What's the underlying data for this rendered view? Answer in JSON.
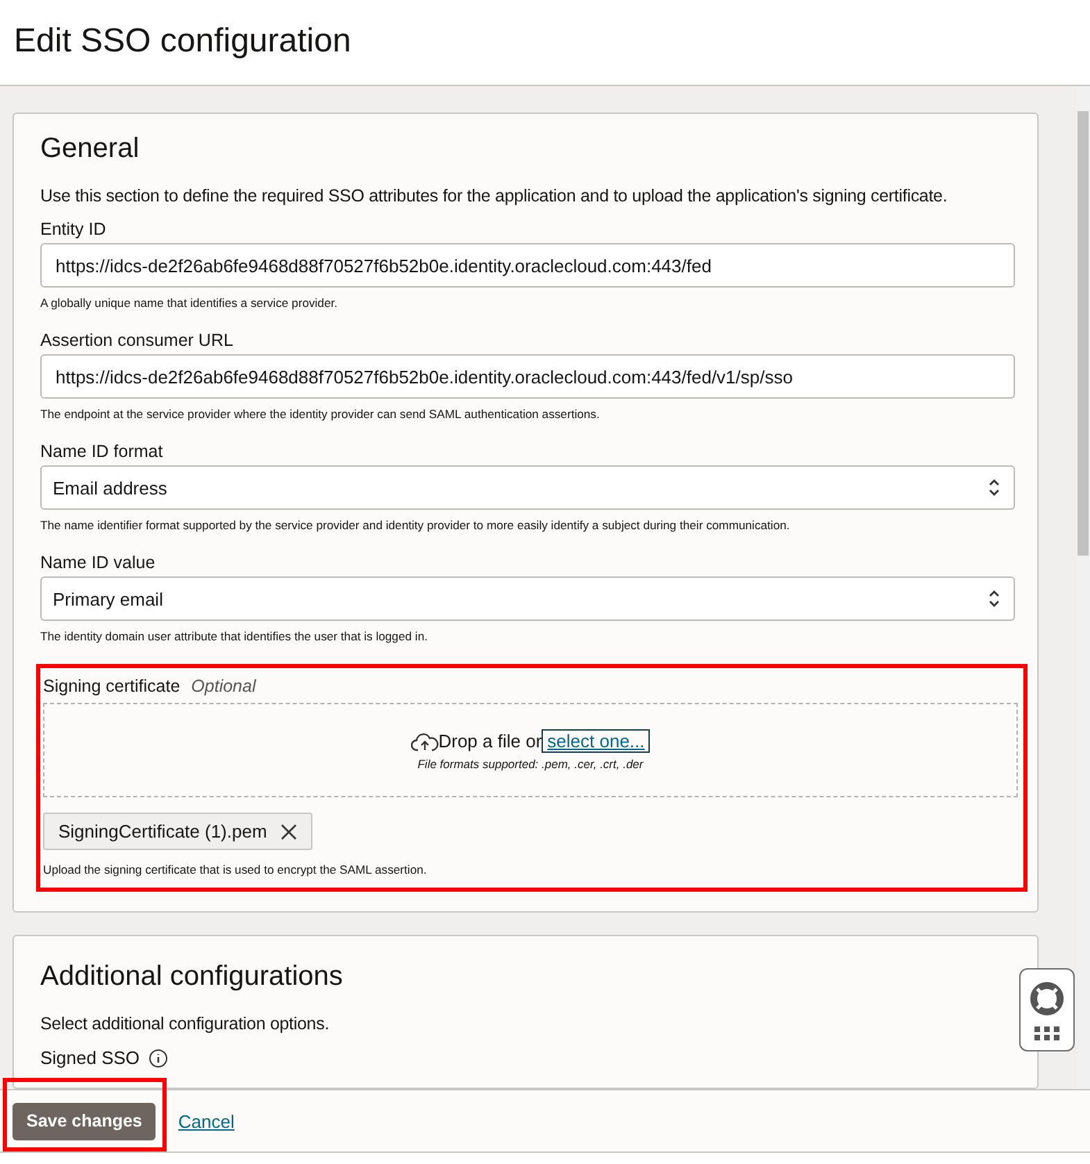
{
  "page": {
    "title": "Edit SSO configuration"
  },
  "general": {
    "title": "General",
    "description": "Use this section to define the required SSO attributes for the application and to upload the application's signing certificate.",
    "fields": [
      {
        "kind": "text",
        "label": "Entity ID",
        "value": "https://idcs-de2f26ab6fe9468d88f70527f6b52b0e.identity.oraclecloud.com:443/fed",
        "help": "A globally unique name that identifies a service provider."
      },
      {
        "kind": "text",
        "label": "Assertion consumer URL",
        "value": "https://idcs-de2f26ab6fe9468d88f70527f6b52b0e.identity.oraclecloud.com:443/fed/v1/sp/sso",
        "help": "The endpoint at the service provider where the identity provider can send SAML authentication assertions."
      },
      {
        "kind": "select",
        "label": "Name ID format",
        "value": "Email address",
        "help": "The name identifier format supported by the service provider and identity provider to more easily identify a subject during their communication."
      },
      {
        "kind": "select",
        "label": "Name ID value",
        "value": "Primary email",
        "help": "The identity domain user attribute that identifies the user that is logged in."
      }
    ],
    "signing_certificate": {
      "label": "Signing certificate",
      "optional": "Optional",
      "highlighted": true,
      "drop_text": "Drop a file or",
      "select_link": "select one...",
      "formats": "File formats supported: .pem, .cer, .crt, .der",
      "file": "SigningCertificate (1).pem",
      "help": "Upload the signing certificate that is used to encrypt the SAML assertion."
    }
  },
  "additional": {
    "title": "Additional configurations",
    "description": "Select additional configuration options.",
    "signed_sso_label": "Signed SSO"
  },
  "footer": {
    "save": {
      "label": "Save changes",
      "highlighted": true
    },
    "cancel": "Cancel"
  }
}
